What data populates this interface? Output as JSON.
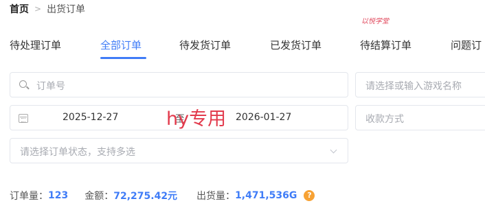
{
  "breadcrumb": {
    "home": "首页",
    "separator": ">",
    "current": "出货订单"
  },
  "tabs": [
    {
      "label": "待处理订单",
      "active": false
    },
    {
      "label": "全部订单",
      "active": true
    },
    {
      "label": "待发货订单",
      "active": false
    },
    {
      "label": "已发货订单",
      "active": false
    },
    {
      "label": "待结算订单",
      "active": false
    },
    {
      "label": "问题订",
      "active": false
    }
  ],
  "watermark_small": "以悦学堂",
  "filters": {
    "order_no_placeholder": "订单号",
    "game_placeholder": "请选择或输入游戏名称",
    "date_start": "2025-12-27",
    "date_separator": "至",
    "date_end": "2026-01-27",
    "payment_placeholder": "收款方式",
    "status_placeholder": "请选择订单状态，支持多选"
  },
  "overlay_text": "hy专用",
  "stats": {
    "order_count_label": "订单量：",
    "order_count": "123",
    "amount_label": "金额：",
    "amount": "72,275.42元",
    "shipped_label": "出货量：",
    "shipped": "1,471,536G",
    "help_symbol": "?"
  },
  "colors": {
    "accent": "#3f7cf7",
    "help": "#f7a234",
    "overlay": "#e23a4c"
  },
  "icons": [
    "search-icon",
    "calendar-icon",
    "chevron-down-icon",
    "help-icon"
  ]
}
